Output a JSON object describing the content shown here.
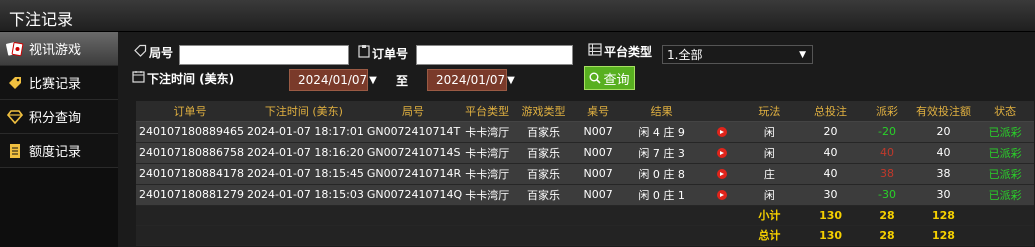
{
  "window": {
    "title": "下注记录"
  },
  "sidebar": {
    "items": [
      {
        "label": "视讯游戏",
        "icon": "cards-icon"
      },
      {
        "label": "比赛记录",
        "icon": "tag-icon"
      },
      {
        "label": "积分查询",
        "icon": "diamond-icon"
      },
      {
        "label": "额度记录",
        "icon": "document-icon"
      }
    ]
  },
  "filters": {
    "round_label": "局号",
    "order_label": "订单号",
    "platform_label": "平台类型",
    "platform_value": "1.全部",
    "time_label": "下注时间 (美东)",
    "date_from": "2024/01/07",
    "to_label": "至",
    "date_to": "2024/01/07",
    "query_label": "查询"
  },
  "table": {
    "headers": [
      "订单号",
      "下注时间 (美东)",
      "局号",
      "平台类型",
      "游戏类型",
      "桌号",
      "结果",
      "",
      "玩法",
      "总投注",
      "派彩",
      "有效投注额",
      "状态"
    ],
    "rows": [
      {
        "order": "240107180889465",
        "time": "2024-01-07 18:17:01",
        "round": "GN0072410714T",
        "platform": "卡卡湾厅",
        "game": "百家乐",
        "table": "N007",
        "result": "闲 4 庄 9",
        "play": "闲",
        "bet": "20",
        "payout": "-20",
        "valid": "20",
        "status": "已派彩"
      },
      {
        "order": "240107180886758",
        "time": "2024-01-07 18:16:20",
        "round": "GN0072410714S",
        "platform": "卡卡湾厅",
        "game": "百家乐",
        "table": "N007",
        "result": "闲 7 庄 3",
        "play": "闲",
        "bet": "40",
        "payout": "40",
        "valid": "40",
        "status": "已派彩"
      },
      {
        "order": "240107180884178",
        "time": "2024-01-07 18:15:45",
        "round": "GN0072410714R",
        "platform": "卡卡湾厅",
        "game": "百家乐",
        "table": "N007",
        "result": "闲 0 庄 8",
        "play": "庄",
        "bet": "40",
        "payout": "38",
        "valid": "38",
        "status": "已派彩"
      },
      {
        "order": "240107180881279",
        "time": "2024-01-07 18:15:03",
        "round": "GN0072410714Q",
        "platform": "卡卡湾厅",
        "game": "百家乐",
        "table": "N007",
        "result": "闲 0 庄 1",
        "play": "闲",
        "bet": "30",
        "payout": "-30",
        "valid": "30",
        "status": "已派彩"
      }
    ],
    "subtotal": {
      "label": "小计",
      "bet": "130",
      "payout": "28",
      "valid": "128"
    },
    "total": {
      "label": "总计",
      "bet": "130",
      "payout": "28",
      "valid": "128"
    }
  },
  "colors": {
    "accent_gold": "#e0b040",
    "query_green": "#58b020",
    "positive": "#29d129",
    "negative_loss": "#c0392b",
    "total_yellow": "#f5d000"
  }
}
